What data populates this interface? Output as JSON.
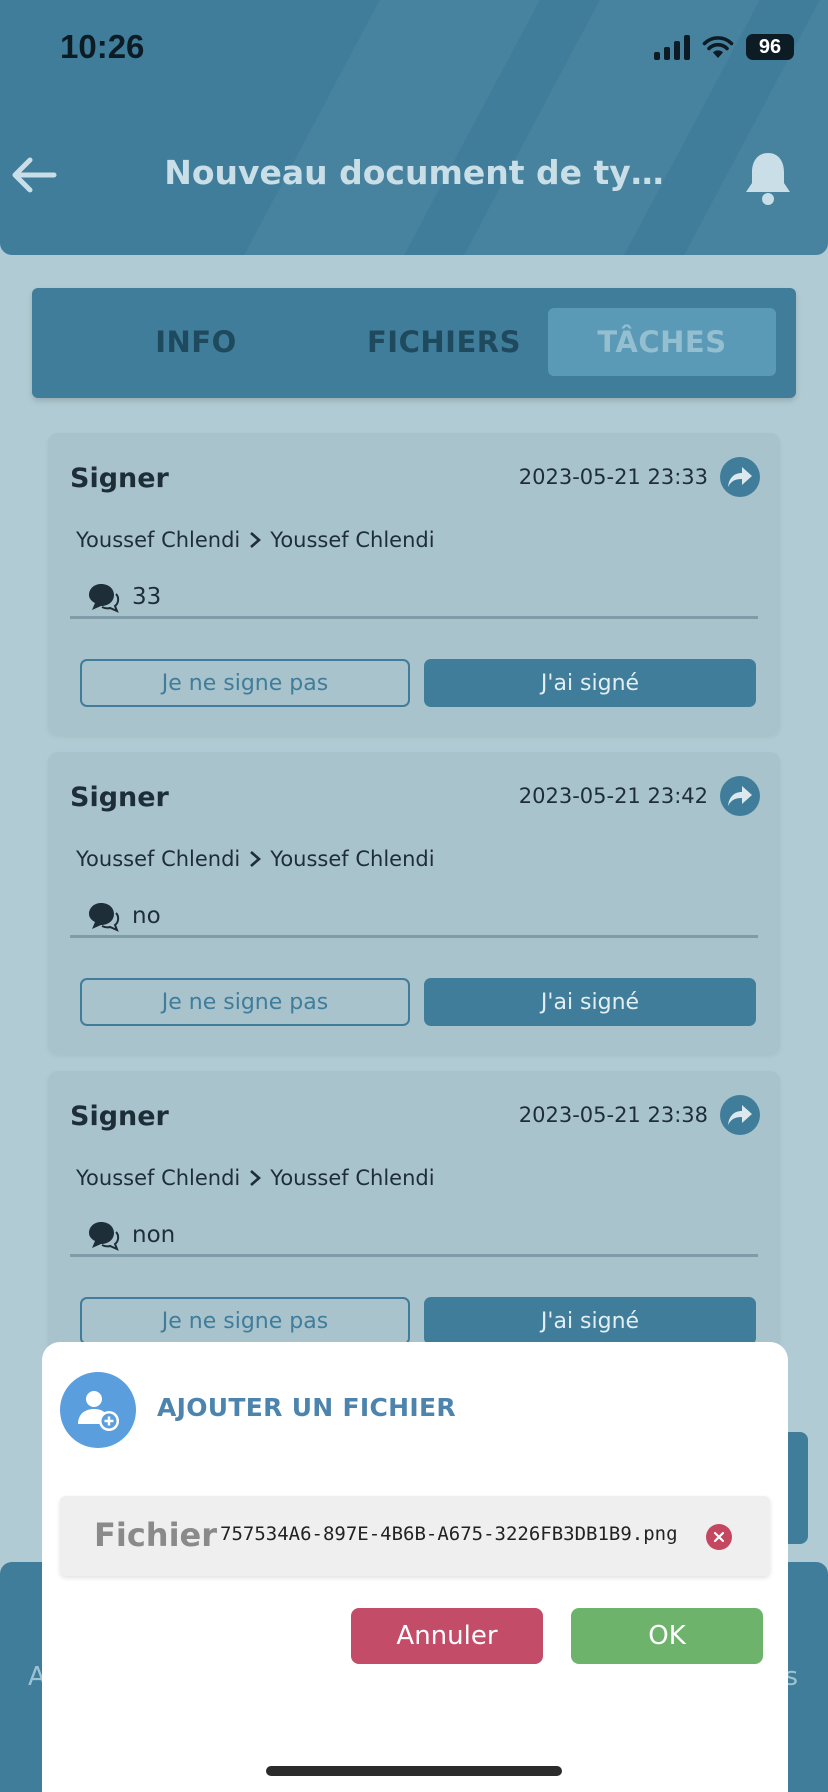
{
  "status_bar": {
    "time": "10:26",
    "battery": "96"
  },
  "header": {
    "title": "Nouveau document de ty…"
  },
  "tabs": [
    {
      "label": "INFO"
    },
    {
      "label": "FICHIERS"
    },
    {
      "label": "TÂCHES",
      "active": true
    }
  ],
  "tasks": [
    {
      "title": "Signer",
      "date": "2023-05-21 23:33",
      "from": "Youssef Chlendi",
      "to": "Youssef Chlendi",
      "comment": "33",
      "refuse_label": "Je ne signe pas",
      "signed_label": "J'ai signé"
    },
    {
      "title": "Signer",
      "date": "2023-05-21 23:42",
      "from": "Youssef Chlendi",
      "to": "Youssef Chlendi",
      "comment": "no",
      "refuse_label": "Je ne signe pas",
      "signed_label": "J'ai signé"
    },
    {
      "title": "Signer",
      "date": "2023-05-21 23:38",
      "from": "Youssef Chlendi",
      "to": "Youssef Chlendi",
      "comment": "non",
      "refuse_label": "Je ne signe pas",
      "signed_label": "J'ai signé"
    }
  ],
  "bottom_nav": {
    "left_edge": "A",
    "right_edge": "s"
  },
  "modal": {
    "title": "AJOUTER UN FICHIER",
    "file_label": "Fichier",
    "file_name": "757534A6-897E-4B6B-A675-3226FB3DB1B9.png",
    "cancel_label": "Annuler",
    "ok_label": "OK"
  },
  "icons": {
    "back": "arrow-left-icon",
    "bell": "bell-icon",
    "share": "share-icon",
    "comment": "comment-icon",
    "route": "chevron-right-icon",
    "avatar": "user-add-icon",
    "remove": "close-icon"
  },
  "colors": {
    "primary": "#3f7d9b",
    "background": "#b1cbd4",
    "card": "#a9c3cd",
    "cancel": "#c34c68",
    "ok": "#6db36c",
    "avatar": "#5b9ede"
  }
}
